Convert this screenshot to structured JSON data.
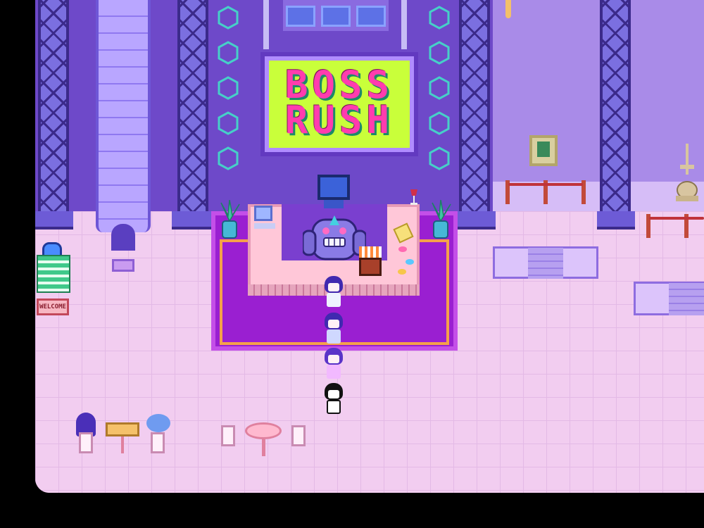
{
  "scene": {
    "sign": {
      "line1": "BOSS",
      "line2": "RUSH"
    },
    "welcome_mat": "WELCOME",
    "colors": {
      "wall": "#6e49c9",
      "floor": "#f2cdf0",
      "sign_bg": "#c9ff3a",
      "sign_text": "#ff3cae",
      "rug": "#9a1fd1"
    }
  },
  "party": [
    "player-leader",
    "party-member-2",
    "party-member-3",
    "omori"
  ],
  "icons": [
    "computer-icon",
    "tv-monitor-icon",
    "wine-glass-icon",
    "candy-icon",
    "cake-icon",
    "plant-icon",
    "painting-icon",
    "statue-icon",
    "mailbox-icon",
    "lamp-icon"
  ]
}
